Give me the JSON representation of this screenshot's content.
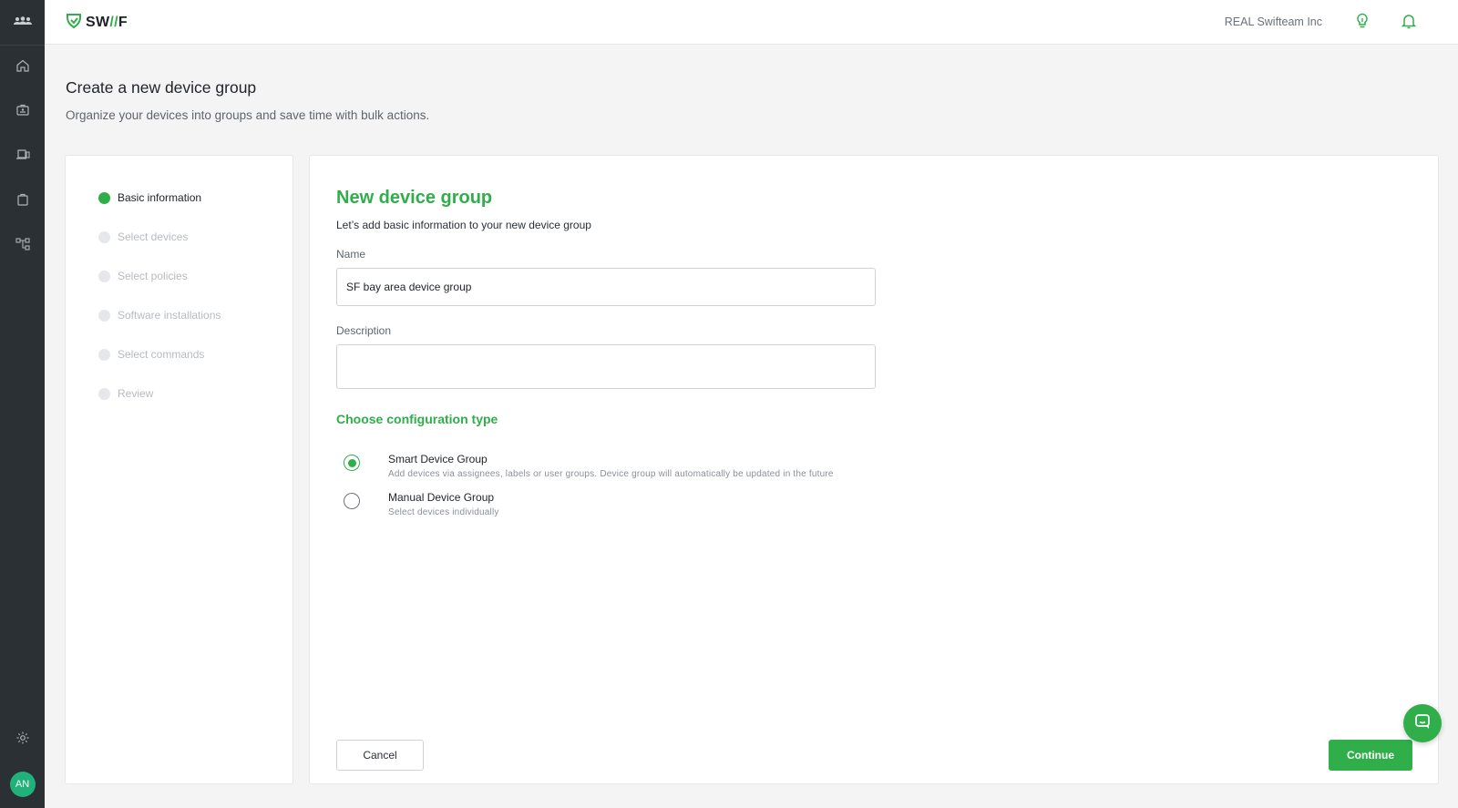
{
  "brand": {
    "logo_text": "SW",
    "logo_slash": "//",
    "logo_tail": "F",
    "accent": "#2fae4a"
  },
  "topbar": {
    "org_name": "REAL Swifteam Inc"
  },
  "rail": {
    "avatar_initials": "AN"
  },
  "page": {
    "title": "Create a new device group",
    "subtitle": "Organize your devices into groups and save time with bulk actions."
  },
  "steps": [
    {
      "label": "Basic information",
      "active": true
    },
    {
      "label": "Select devices",
      "active": false
    },
    {
      "label": "Select policies",
      "active": false
    },
    {
      "label": "Software installations",
      "active": false
    },
    {
      "label": "Select commands",
      "active": false
    },
    {
      "label": "Review",
      "active": false
    }
  ],
  "form": {
    "title": "New device group",
    "description": "Let’s add basic information to your new device group",
    "name_label": "Name",
    "name_value": "SF bay area device group",
    "description_label": "Description",
    "description_value": "",
    "config_title": "Choose configuration type",
    "options": [
      {
        "label": "Smart Device Group",
        "hint": "Add devices via assignees, labels or user groups. Device group will automatically be updated in the future",
        "checked": true
      },
      {
        "label": "Manual Device Group",
        "hint": "Select devices individually",
        "checked": false
      }
    ],
    "cancel_label": "Cancel",
    "continue_label": "Continue"
  },
  "icons": [
    "team-icon",
    "home-icon",
    "devices-icon",
    "laptop-icon",
    "apps-icon",
    "hierarchy-icon",
    "settings-icon",
    "lightbulb-icon",
    "bell-icon",
    "chat-icon"
  ]
}
